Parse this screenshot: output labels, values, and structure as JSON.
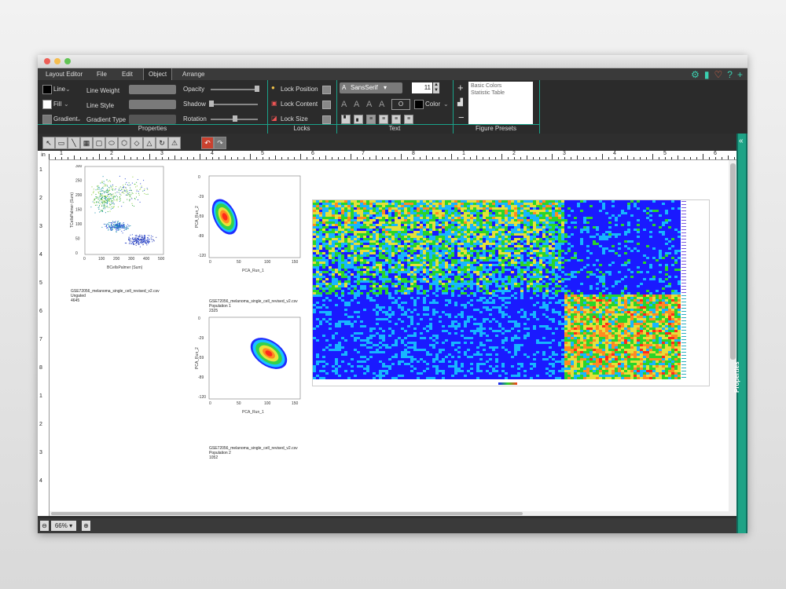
{
  "menu": {
    "items": [
      "Layout Editor",
      "File",
      "Edit",
      "Object",
      "Arrange"
    ]
  },
  "ribbon": {
    "line_label": "Line",
    "fill_label": "Fill",
    "gradient_label": "Gradient",
    "line_weight_label": "Line Weight",
    "line_style_label": "Line Style",
    "gradient_type_label": "Gradient Type",
    "opacity_label": "Opacity",
    "shadow_label": "Shadow",
    "rotation_label": "Rotation",
    "lock_position_label": "Lock Position",
    "lock_content_label": "Lock Content",
    "lock_size_label": "Lock Size",
    "font_value": "SansSerif",
    "font_size_value": "11",
    "color_label": "Color",
    "section_properties": "Properties",
    "section_locks": "Locks",
    "section_text": "Text",
    "section_presets": "Figure Presets",
    "presets": [
      "Basic Colors",
      "Statistic Table"
    ]
  },
  "ruler": {
    "unit": "in",
    "top_numbers": [
      "1",
      "2",
      "3",
      "4",
      "5",
      "6",
      "7",
      "8",
      "1",
      "2",
      "3",
      "4",
      "5",
      "6"
    ],
    "left_numbers": [
      "1",
      "2",
      "3",
      "4",
      "5",
      "6",
      "7",
      "8",
      "1",
      "2",
      "3",
      "4"
    ]
  },
  "status": {
    "zoom": "66%"
  },
  "side_panel": {
    "title": "Properties"
  },
  "figures": {
    "scatter1": {
      "xlabel": "BCellsPalmer (Sum)",
      "ylabel": "TCellsPalmer (Sum)",
      "xticks": [
        "0",
        "100",
        "200",
        "300",
        "400",
        "500"
      ],
      "yticks": [
        "0",
        "50",
        "100",
        "150",
        "200",
        "250",
        "300"
      ],
      "caption": [
        "GSE72056_melanoma_single_cell_revised_v2.csv",
        "Ungated",
        "4645"
      ]
    },
    "pca1": {
      "xlabel": "PCA_Run_1",
      "ylabel": "PCA_Run_2",
      "xticks": [
        "0",
        "50",
        "100",
        "150"
      ],
      "yticks": [
        "0",
        "-29",
        "-59",
        "-89",
        "-120"
      ],
      "caption": [
        "GSE72056_melanoma_single_cell_revised_v2.csv",
        "Population 1",
        "2325"
      ]
    },
    "pca2": {
      "xlabel": "PCA_Run_1",
      "ylabel": "PCA_Run_2",
      "xticks": [
        "0",
        "50",
        "100",
        "150"
      ],
      "yticks": [
        "0",
        "-29",
        "-59",
        "-89",
        "-120"
      ],
      "caption": [
        "GSE72056_melanoma_single_cell_revised_v2.csv",
        "Population 2",
        "1052"
      ]
    }
  },
  "colors": {
    "accent": "#1ea386",
    "heat_low": "#1a1aff",
    "heat_mid": "#2ad52a",
    "heat_high": "#ff3a1a"
  }
}
